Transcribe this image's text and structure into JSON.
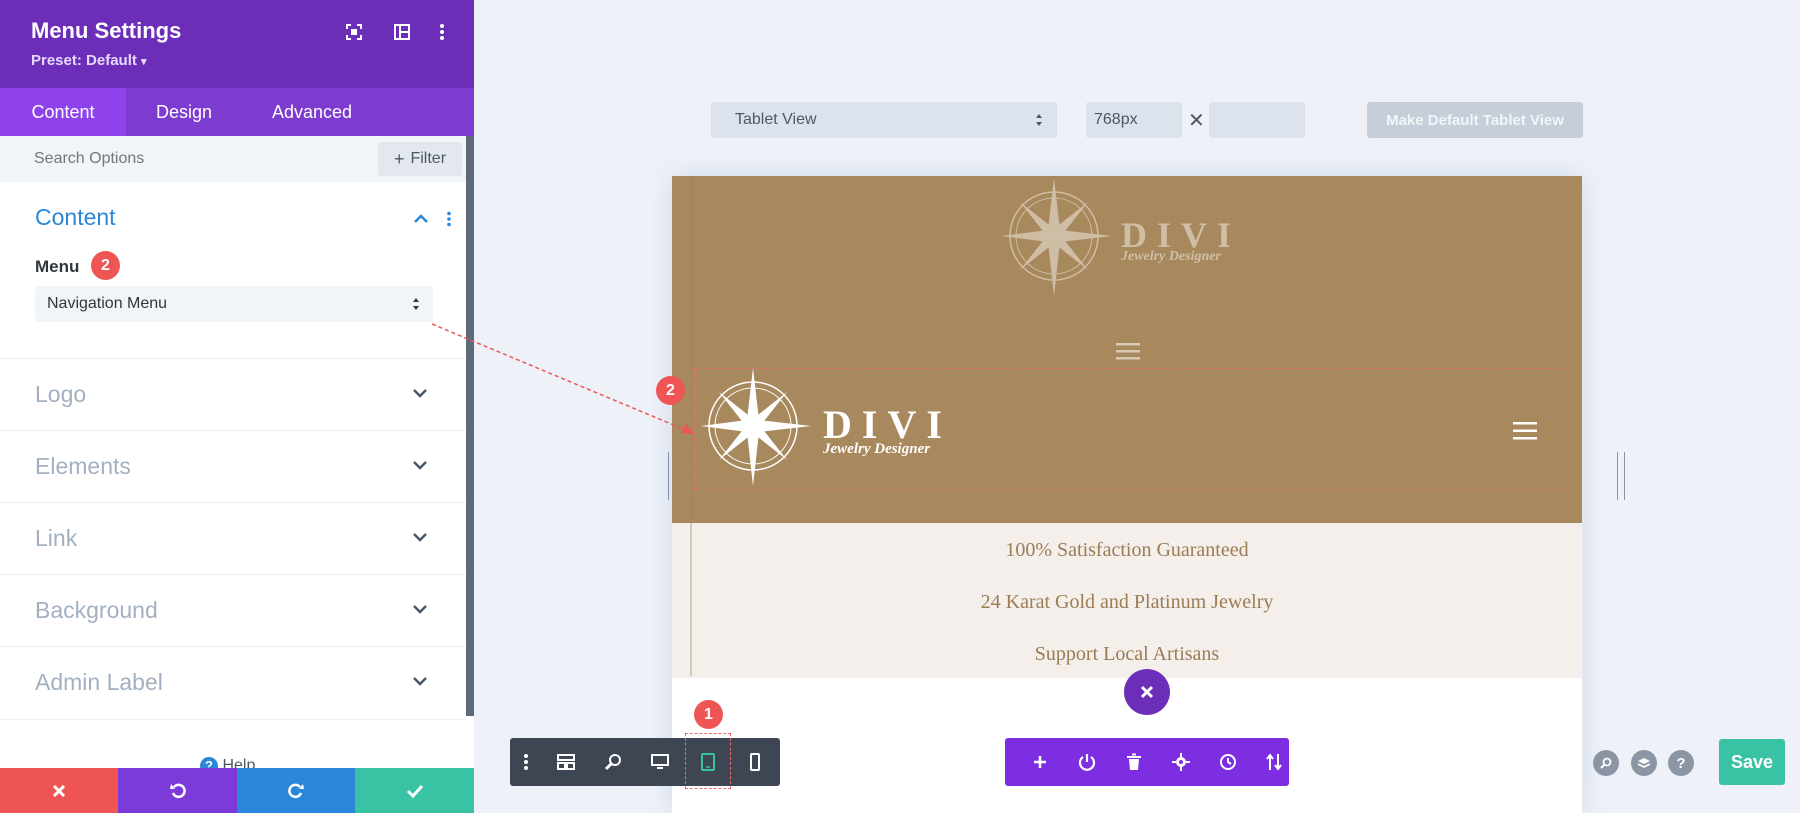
{
  "panel": {
    "title": "Menu Settings",
    "preset": "Preset: Default",
    "tabs": [
      {
        "label": "Content",
        "active": true
      },
      {
        "label": "Design"
      },
      {
        "label": "Advanced"
      }
    ],
    "search_placeholder": "Search Options",
    "filter_label": "Filter",
    "content_section_title": "Content",
    "menu_field_label": "Menu",
    "menu_field_badge": "2",
    "menu_selected": "Navigation Menu",
    "groups": [
      "Logo",
      "Elements",
      "Link",
      "Background",
      "Admin Label"
    ],
    "help_label": "Help",
    "accent_color": "#6c2eb9"
  },
  "preview_toolbar": {
    "view_select": "Tablet View",
    "width_value": "768px",
    "times_sign": "✕",
    "height_value": "",
    "make_default_label": "Make Default Tablet View"
  },
  "preview": {
    "logo_word": "DIVI",
    "logo_tagline": "Jewelry Designer",
    "menu_highlight_badge": "2",
    "info_lines": [
      "100% Satisfaction Guaranteed",
      "24 Karat Gold and Platinum Jewelry",
      "Support Local Artisans"
    ],
    "header_color": "#a8895d"
  },
  "bottom_bar": {
    "view_badge": "1",
    "save_label": "Save",
    "save_color": "#39c2a4"
  }
}
